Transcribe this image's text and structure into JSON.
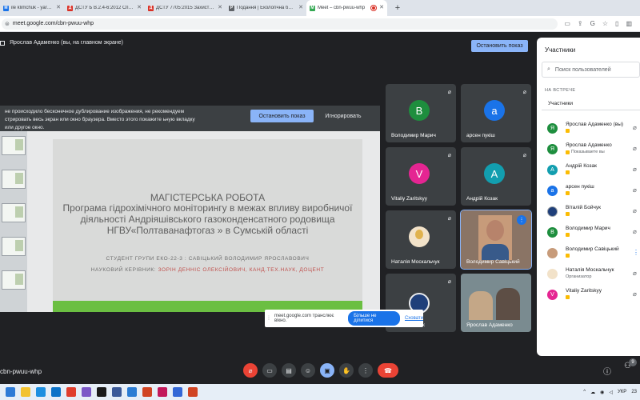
{
  "browser": {
    "tabs": [
      {
        "title": "ile klimchuk - yarad1964@",
        "favicon_color": "#1a73e8",
        "favicon_glyph": "M"
      },
      {
        "title": "ДСТУ Б В.2.4-6:2012 Споруди",
        "favicon_color": "#d93025",
        "favicon_glyph": "Д"
      },
      {
        "title": "ДСТУ 7705:2015 Захист довкіл",
        "favicon_color": "#d93025",
        "favicon_glyph": "Д"
      },
      {
        "title": "Подання | Екологічна безпека",
        "favicon_color": "#5f6368",
        "favicon_glyph": "P"
      },
      {
        "title": "Meet – cbn-pwuu-whp",
        "favicon_color": "#34a853",
        "favicon_glyph": "M"
      }
    ],
    "url": "meet.google.com/cbn-pwuu-whp"
  },
  "meet": {
    "presenter_status": "Ярослав Адаменко (вы, на главном экране)",
    "stop_show_label": "Остановить показ",
    "warning_text": "не происходило бесконечное дублирование изображения, не рекомендуем стрировать весь экран или окно браузера. Вместо этого покажите ьную вкладку или другое окно.",
    "warning_stop_label": "Остановить показ",
    "warning_ignore_label": "Игнорировать",
    "slide": {
      "title": "МАГІСТЕРСЬКА РОБОТА",
      "subtitle": "Програма гідрохімічного моніторингу в межах впливу виробничої діяльності Андріяшівського газоконденсатного родовища НГВУ«Полтаванафтогаз » в Сумській області",
      "student_line": "СТУДЕНТ ГРУПИ ЕКО-22-3 : САВІЦЬКИЙ ВОЛОДИМИР ЯРОСЛАВОВИЧ",
      "supervisor_prefix": "НАУКОВИЙ КЕРІВНИК:",
      "supervisor_name": "ЗОРІН ДЕННІС ОЛЕКСІЙОВИЧ, КАНД.ТЕХ.НАУК, ДОЦЕНТ"
    },
    "tiles": [
      {
        "name": "Володимир Марич",
        "initial": "В",
        "color": "#1e8e3e"
      },
      {
        "name": "арсен пукіш",
        "initial": "а",
        "color": "#1a73e8"
      },
      {
        "name": "Vitaliy Zaritskyy",
        "initial": "V",
        "color": "#e52592"
      },
      {
        "name": "Андрій Козак",
        "initial": "А",
        "color": "#129eaf"
      },
      {
        "name": "Наталія Москальчук",
        "initial": "",
        "color": "#f2e2c9"
      },
      {
        "name": "Володимир Савіцький",
        "initial": "",
        "color": "#c79b7a"
      },
      {
        "name": "к",
        "initial": "",
        "color": "#1f3f7a"
      },
      {
        "name": "Ярослав Адаменко",
        "initial": "",
        "color": "#7a8b90"
      }
    ],
    "share_toast": {
      "text": "meet.google.com транслює вікно.",
      "stop_label": "Більше не ділитися",
      "hide_label": "Сховати"
    },
    "meeting_code": "cbn-pwuu-whp",
    "people_count": "9"
  },
  "participants_panel": {
    "title": "Участники",
    "search_placeholder": "Поиск пользователей",
    "section": "НА ВСТРЕЧЕ",
    "subsection": "Участники",
    "people": [
      {
        "name": "Ярослав Адаменко (вы)",
        "note": "",
        "initial": "Я",
        "color": "#1e8e3e"
      },
      {
        "name": "Ярослав Адаменко",
        "note": "Показываете вы",
        "initial": "Я",
        "color": "#1e8e3e"
      },
      {
        "name": "Андрій Козак",
        "note": "",
        "initial": "А",
        "color": "#129eaf"
      },
      {
        "name": "арсен пукіш",
        "note": "",
        "initial": "а",
        "color": "#1a73e8"
      },
      {
        "name": "Віталій Бойчук",
        "note": "",
        "initial": "",
        "color": "#1f3f7a"
      },
      {
        "name": "Володимир Марич",
        "note": "",
        "initial": "В",
        "color": "#1e8e3e"
      },
      {
        "name": "Володимир Савіцький",
        "note": "",
        "initial": "",
        "color": "#c79b7a"
      },
      {
        "name": "Наталія Москальчук",
        "note": "Организатор",
        "initial": "",
        "color": "#f2e2c9"
      },
      {
        "name": "Vitaliy Zaritskyy",
        "note": "",
        "initial": "V",
        "color": "#e52592"
      }
    ]
  },
  "taskbar": {
    "lang": "УКР",
    "time": "23"
  }
}
